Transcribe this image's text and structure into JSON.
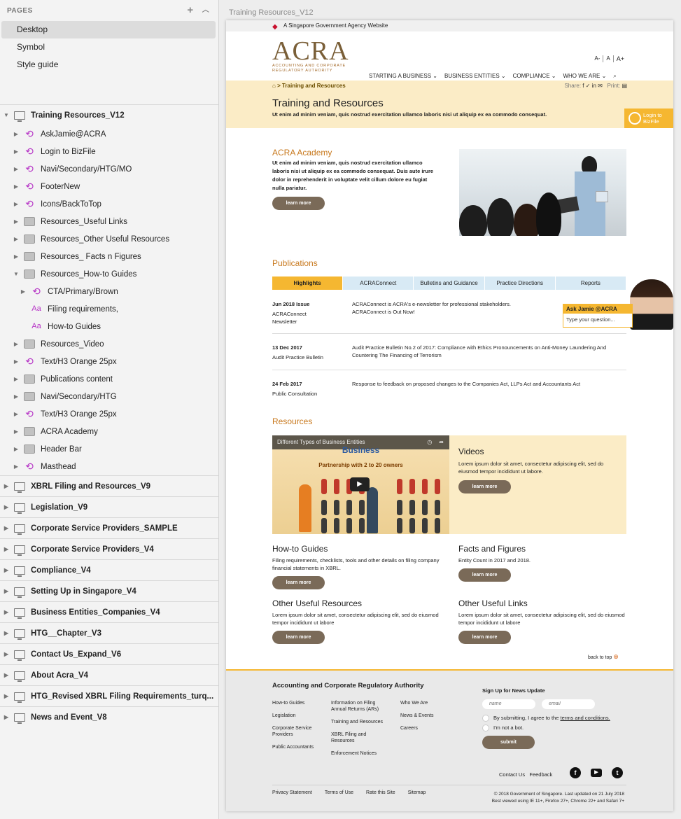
{
  "sidebar": {
    "pages_label": "PAGES",
    "pages": [
      "Desktop",
      "Symbol",
      "Style guide"
    ],
    "artboard_open": {
      "name": "Training Resources_V12",
      "layers": [
        {
          "name": "AskJamie@ACRA",
          "type": "symbol",
          "indent": 1
        },
        {
          "name": "Login to BizFile",
          "type": "symbol",
          "indent": 1
        },
        {
          "name": "Navi/Secondary/HTG/MO",
          "type": "symbol",
          "indent": 1
        },
        {
          "name": "FooterNew",
          "type": "symbol",
          "indent": 1
        },
        {
          "name": "Icons/BackToTop",
          "type": "symbol",
          "indent": 1
        },
        {
          "name": "Resources_Useful Links",
          "type": "folder",
          "indent": 1
        },
        {
          "name": "Resources_Other Useful Resources",
          "type": "folder",
          "indent": 1
        },
        {
          "name": "Resources_ Facts n Figures",
          "type": "folder",
          "indent": 1
        },
        {
          "name": "Resources_How-to Guides",
          "type": "folder",
          "indent": 1,
          "open": true
        },
        {
          "name": "CTA/Primary/Brown",
          "type": "symbol",
          "indent": 2
        },
        {
          "name": "Filing requirements,",
          "type": "text",
          "indent": 2
        },
        {
          "name": "How-to Guides",
          "type": "text",
          "indent": 2
        },
        {
          "name": "Resources_Video",
          "type": "folder",
          "indent": 1
        },
        {
          "name": "Text/H3 Orange 25px",
          "type": "symbol",
          "indent": 1
        },
        {
          "name": "Publications content",
          "type": "folder",
          "indent": 1
        },
        {
          "name": "Navi/Secondary/HTG",
          "type": "folder",
          "indent": 1
        },
        {
          "name": "Text/H3 Orange 25px",
          "type": "symbol",
          "indent": 1
        },
        {
          "name": "ACRA Academy",
          "type": "folder",
          "indent": 1
        },
        {
          "name": "Header Bar",
          "type": "folder",
          "indent": 1
        },
        {
          "name": "Masthead",
          "type": "symbol",
          "indent": 1
        }
      ]
    },
    "artboards": [
      "XBRL Filing and Resources_V9",
      "Legislation_V9",
      "Corporate Service Providers_SAMPLE",
      "Corporate Service Providers_V4",
      "Compliance_V4",
      "Setting Up in Singapore_V4",
      "Business Entities_Companies_V4",
      "HTG__Chapter_V3",
      "Contact Us_Expand_V6",
      "About Acra_V4",
      "HTG_Revised XBRL Filing Requirements_turq...",
      "News and Event_V8"
    ]
  },
  "canvas": {
    "title": "Training Resources_V12"
  },
  "site": {
    "gov_banner": "A Singapore Government Agency Website",
    "logo": {
      "big": "ACRA",
      "line1": "ACCOUNTING AND CORPORATE",
      "line2": "REGULATORY AUTHORITY"
    },
    "font_sizes": [
      "A-",
      "A",
      "A+"
    ],
    "nav": [
      "STARTING A BUSINESS",
      "BUSINESS ENTITIES",
      "COMPLIANCE",
      "WHO WE ARE"
    ],
    "breadcrumb": "> Training and Resources",
    "share_label": "Share:",
    "print_label": "Print:",
    "page_title": "Training and Resources",
    "page_subtitle": "Ut enim ad minim veniam, quis nostrud exercitation ullamco laboris nisi ut aliquip ex ea commodo consequat.",
    "bizfile": {
      "line1": "Login to",
      "line2": "BizFile"
    },
    "academy": {
      "title": "ACRA Academy",
      "text": "Ut enim ad minim veniam, quis nostrud exercitation ullamco laboris nisi ut aliquip ex ea commodo consequat. Duis aute irure dolor in reprehenderit in voluptate velit cillum dolore eu fugiat nulla pariatur.",
      "button": "learn more"
    },
    "publications": {
      "title": "Publications",
      "tabs": [
        "Highlights",
        "ACRAConnect",
        "Bulletins and Guidance",
        "Practice Directions",
        "Reports"
      ],
      "items": [
        {
          "date": "Jun 2018 Issue",
          "type": "ACRAConnect Newsletter",
          "text": "ACRAConnect is ACRA's e-newsletter for professional stakeholders. ACRAConnect is Out Now!"
        },
        {
          "date": "13 Dec 2017",
          "type": "Audit Practice Bulletin",
          "text": "Audit Practice Bulletin No.2 of 2017: Compliance with Ethics Pronouncements on Anti-Money Laundering And Countering The Financing of Terrorism"
        },
        {
          "date": "24 Feb 2017",
          "type": "Public Consultation",
          "text": "Response to feedback on proposed changes to the Companies Act, LLPs Act and Accountants Act"
        }
      ]
    },
    "resources": {
      "title": "Resources",
      "video_title": "Different Types of Business Entities",
      "video_word": "Business",
      "video_caption": "Partnership with 2 to 20 owners",
      "cards": [
        {
          "title": "Videos",
          "text": "Lorem ipsum dolor sit amet, consectetur adipiscing elit, sed do eiusmod tempor incididunt ut labore.",
          "button": "learn more"
        },
        {
          "title": "How-to Guides",
          "text": "Filing requirements, checklists, tools and other details on filing company financial statements in XBRL.",
          "button": "learn more"
        },
        {
          "title": "Facts and Figures",
          "text": "Entity Count in 2017 and 2018.",
          "button": "learn more"
        },
        {
          "title": "Other Useful Resources",
          "text": "Lorem ipsum dolor sit amet, consectetur adipiscing elit, sed do eiusmod tempor incididunt ut labore",
          "button": "learn more"
        },
        {
          "title": "Other Useful Links",
          "text": "Lorem ipsum dolor sit amet, consectetur adipiscing elit, sed do eiusmod tempor incididunt ut labore",
          "button": "learn more"
        }
      ]
    },
    "back_to_top": "back to top",
    "ask_jamie": {
      "title": "Ask Jamie @ACRA",
      "placeholder": "Type your question..."
    },
    "footer": {
      "org": "Accounting and Corporate Regulatory Authority",
      "col1": [
        "How-to Guides",
        "Legislation",
        "Corporate Service Providers",
        "Public Accountants"
      ],
      "col2": [
        "Information on Filing Annual Returns (ARs)",
        "Training and Resources",
        "XBRL Filing and Resources",
        "Enforcement Notices"
      ],
      "col3": [
        "Who We Are",
        "News & Events",
        "Careers"
      ],
      "signup_title": "Sign Up for News Update",
      "name_placeholder": "name",
      "email_placeholder": "email",
      "agree_prefix": "By submitting, I agree to the",
      "agree_link": "terms and conditions.",
      "not_bot": "I'm not a bot.",
      "submit": "submit",
      "contact": "Contact Us",
      "feedback": "Feedback",
      "bottom_links": [
        "Privacy Statement",
        "Terms of Use",
        "Rate this Site",
        "Sitemap"
      ],
      "copyright": "© 2018 Government of Singapore. Last updated on 21 July 2018",
      "best_viewed": "Best viewed using IE 11+, Firefox 27+, Chrome 22+ and Safari 7+"
    }
  },
  "colors": {
    "accent": "#f5b731",
    "brown": "#7a6a58",
    "orange_heading": "#c8791e",
    "banner": "#fbecc6"
  }
}
